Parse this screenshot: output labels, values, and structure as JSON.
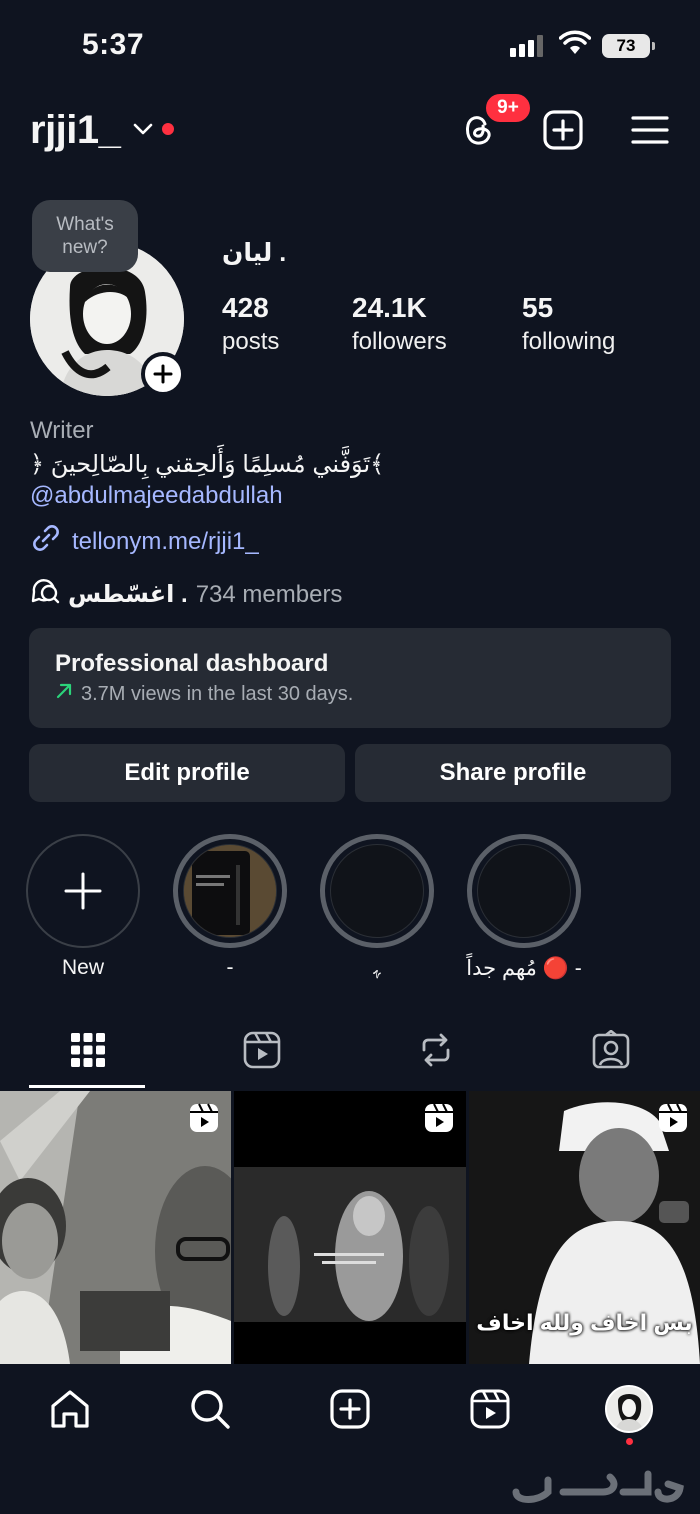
{
  "status_bar": {
    "time": "5:37",
    "battery": "73"
  },
  "header": {
    "username": "rjji1_",
    "notifications_badge": "9+"
  },
  "profile": {
    "avatar_prompt": "What's new?",
    "display_name": "ليان .",
    "stats": [
      {
        "value": "428",
        "label": "posts"
      },
      {
        "value": "24.1K",
        "label": "followers"
      },
      {
        "value": "55",
        "label": "following"
      }
    ],
    "category": "Writer",
    "bio": "﴿ تَوَفَّني مُسلِمًا وَأَلحِقني بِالصّالِحينَ﴾",
    "mention": "@abdulmajeedabdullah",
    "link": "tellonym.me/rjji1_",
    "channel": {
      "name": "اغسّطس .",
      "members": "734 members"
    }
  },
  "dashboard": {
    "title": "Professional dashboard",
    "subtitle": "3.7M views in the last 30 days."
  },
  "buttons": {
    "edit": "Edit profile",
    "share": "Share profile"
  },
  "highlights": [
    {
      "label": "New"
    },
    {
      "label": "-"
    },
    {
      "label": "ﮩ"
    },
    {
      "label": "مُهم جداً 🔴 -"
    }
  ],
  "tabs": [
    "posts-grid",
    "reels",
    "reposts",
    "tagged"
  ],
  "grid": [
    {
      "type": "reel",
      "caption": ""
    },
    {
      "type": "reel",
      "caption": ""
    },
    {
      "type": "reel",
      "caption": "بس اخاف ولله اخاف"
    }
  ],
  "watermark": "حراج",
  "colors": {
    "background": "#0f1420",
    "card": "#262b34",
    "accent_link": "#a6b8ff",
    "notification": "#ff3040",
    "trend_up": "#2bd47a"
  }
}
